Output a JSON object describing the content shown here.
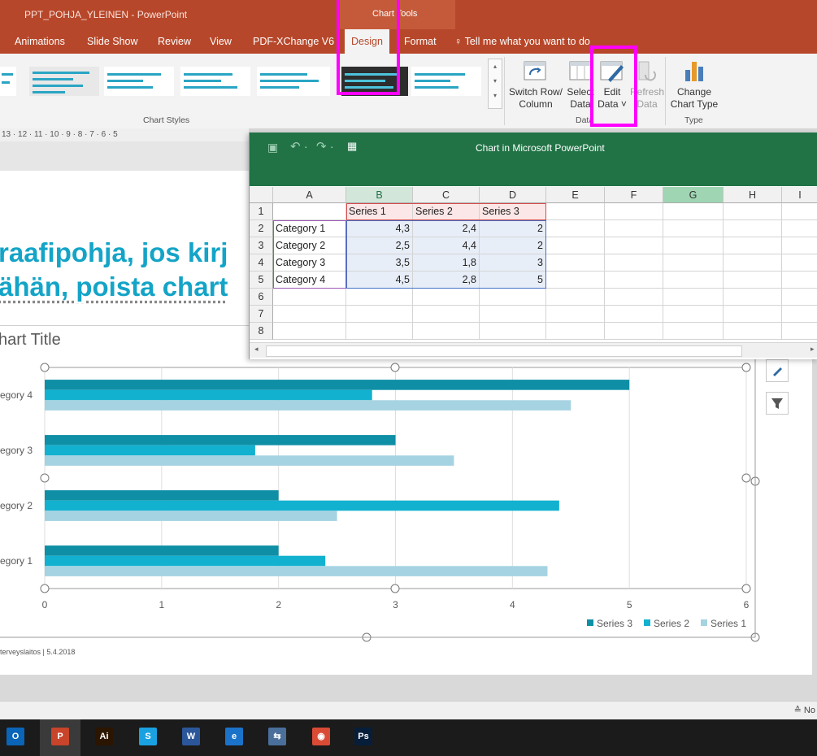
{
  "window": {
    "title": "PPT_POHJA_YLEINEN  -  PowerPoint",
    "context_group": "Chart Tools"
  },
  "tabs": [
    {
      "label": "Animations"
    },
    {
      "label": "Slide Show"
    },
    {
      "label": "Review"
    },
    {
      "label": "View"
    },
    {
      "label": "PDF-XChange V6"
    },
    {
      "label": "Design"
    },
    {
      "label": "Format"
    }
  ],
  "tell_me": "Tell me what you want to do",
  "ribbon": {
    "chart_styles_label": "Chart Styles",
    "data_group_label": "Data",
    "type_group_label": "Type",
    "switch_row_col": [
      "Switch Row/",
      "Column"
    ],
    "select_data": [
      "Select",
      "Data"
    ],
    "edit_data": [
      "Edit",
      "Data ˅"
    ],
    "refresh_data": [
      "Refresh",
      "Data"
    ],
    "change_chart_type": [
      "Change",
      "Chart Type"
    ]
  },
  "ruler": "13 · 12 · 11 · 10 · 9 · 8 · 7 · 6 · 5",
  "slide": {
    "heading_line1": "raafipohja, jos kirj",
    "heading_line2": "ähän, poista chart",
    "chart_title": "hart Title",
    "footer": "terveyslaitos   |   5.4.2018"
  },
  "excel": {
    "title": "Chart in Microsoft PowerPoint",
    "columns": [
      "A",
      "B",
      "C",
      "D",
      "E",
      "F",
      "G",
      "H",
      "I"
    ],
    "rows": [
      "1",
      "2",
      "3",
      "4",
      "5",
      "6",
      "7",
      "8"
    ],
    "header": [
      "",
      "Series 1",
      "Series 2",
      "Series 3"
    ],
    "data": [
      [
        "Category 1",
        "4,3",
        "2,4",
        "2"
      ],
      [
        "Category 2",
        "2,5",
        "4,4",
        "2"
      ],
      [
        "Category 3",
        "3,5",
        "1,8",
        "3"
      ],
      [
        "Category 4",
        "4,5",
        "2,8",
        "5"
      ]
    ]
  },
  "chart_data": {
    "type": "bar",
    "orientation": "horizontal",
    "categories": [
      "Category 1",
      "Category 2",
      "Category 3",
      "Category 4"
    ],
    "category_labels_visible": [
      "egory 1",
      "egory 2",
      "egory 3",
      "egory 4"
    ],
    "series": [
      {
        "name": "Series 1",
        "values": [
          4.3,
          2.5,
          3.5,
          4.5
        ],
        "color": "#a5d3e2"
      },
      {
        "name": "Series 2",
        "values": [
          2.4,
          4.4,
          1.8,
          2.8
        ],
        "color": "#13b1d0"
      },
      {
        "name": "Series 3",
        "values": [
          2,
          2,
          3,
          5
        ],
        "color": "#0f8fa6"
      }
    ],
    "xlim": [
      0,
      6
    ],
    "xticks": [
      "0",
      "1",
      "2",
      "3",
      "4",
      "5",
      "6"
    ],
    "grid": true,
    "legend": "bottom-right",
    "legend_order": [
      "Series 3",
      "Series 2",
      "Series 1"
    ]
  },
  "status": {
    "notes": "≙ No"
  },
  "taskbar": [
    {
      "name": "outlook",
      "label": "O",
      "color": "#0a64b8"
    },
    {
      "name": "powerpoint",
      "label": "P",
      "color": "#c8442a"
    },
    {
      "name": "illustrator",
      "label": "Ai",
      "color": "#2b1500"
    },
    {
      "name": "skype",
      "label": "S",
      "color": "#1aa1e1"
    },
    {
      "name": "word",
      "label": "W",
      "color": "#2b579a"
    },
    {
      "name": "ie",
      "label": "e",
      "color": "#1b73c9"
    },
    {
      "name": "network",
      "label": "⇆",
      "color": "#4a6f9a"
    },
    {
      "name": "chrome",
      "label": "◉",
      "color": "#d94b35"
    },
    {
      "name": "photoshop",
      "label": "Ps",
      "color": "#061e3a"
    }
  ]
}
